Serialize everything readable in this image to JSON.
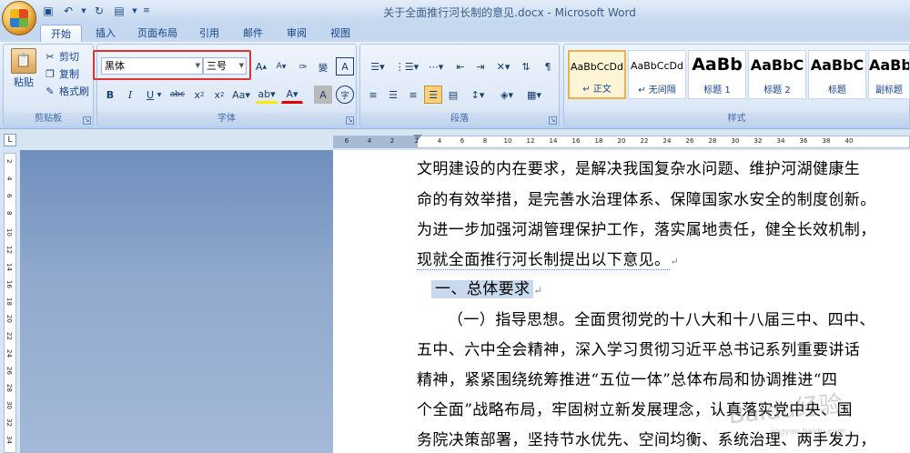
{
  "window": {
    "title": "关于全面推行河长制的意见.docx - Microsoft Word"
  },
  "qat": {
    "save": "save-icon",
    "undo": "undo-icon",
    "redo": "redo-icon",
    "print_preview": "print-preview-icon"
  },
  "tabs": [
    "开始",
    "插入",
    "页面布局",
    "引用",
    "邮件",
    "审阅",
    "视图"
  ],
  "ribbon": {
    "clipboard": {
      "label": "剪贴板",
      "paste": "粘贴",
      "cut": "剪切",
      "copy": "复制",
      "format_painter": "格式刷"
    },
    "font": {
      "label": "字体",
      "font_name": "黑体",
      "font_size": "三号"
    },
    "paragraph": {
      "label": "段落"
    },
    "styles": {
      "label": "样式",
      "items": [
        {
          "sample": "AaBbCcDd",
          "name": "↵ 正文"
        },
        {
          "sample": "AaBbCcDd",
          "name": "↵ 无间隔"
        },
        {
          "sample": "AaBb",
          "name": "标题 1"
        },
        {
          "sample": "AaBbC",
          "name": "标题 2"
        },
        {
          "sample": "AaBbC",
          "name": "标题"
        },
        {
          "sample": "AaBb",
          "name": "副标题"
        }
      ]
    }
  },
  "ruler": {
    "ticks": [
      "6",
      "4",
      "2",
      "2",
      "4",
      "6",
      "8",
      "10",
      "12",
      "14",
      "16",
      "18",
      "20",
      "22",
      "24",
      "26",
      "28",
      "30",
      "32",
      "34",
      "36",
      "38",
      "40"
    ],
    "vticks": [
      "2",
      "4",
      "6",
      "8",
      "10",
      "12",
      "14",
      "16",
      "18",
      "20",
      "22",
      "24",
      "26",
      "28",
      "30",
      "32",
      "34"
    ]
  },
  "document": {
    "lines": [
      "文明建设的内在要求，是解决我国复杂水问题、维护河湖健康生",
      "命的有效举措，是完善水治理体系、保障国家水安全的制度创新。",
      "为进一步加强河湖管理保护工作，落实属地责任，健全长效机制，",
      "现就全面推行河长制提出以下意见。",
      "一、总体要求",
      "（一）指导思想。全面贯彻党的十八大和十八届三中、四中、",
      "五中、六中全会精神，深入学习贯彻习近平总书记系列重要讲话",
      "精神，紧紧围绕统筹推进“五位一体”总体布局和协调推进“四",
      "个全面”战略布局，牢固树立新发展理念，认真落实党中央、国",
      "务院决策部署，坚持节水优先、空间均衡、系统治理、两手发力，"
    ],
    "para_mark": "↵"
  },
  "watermark": {
    "text": "Baidu经验",
    "sub": "jingyan.baidu.com"
  }
}
